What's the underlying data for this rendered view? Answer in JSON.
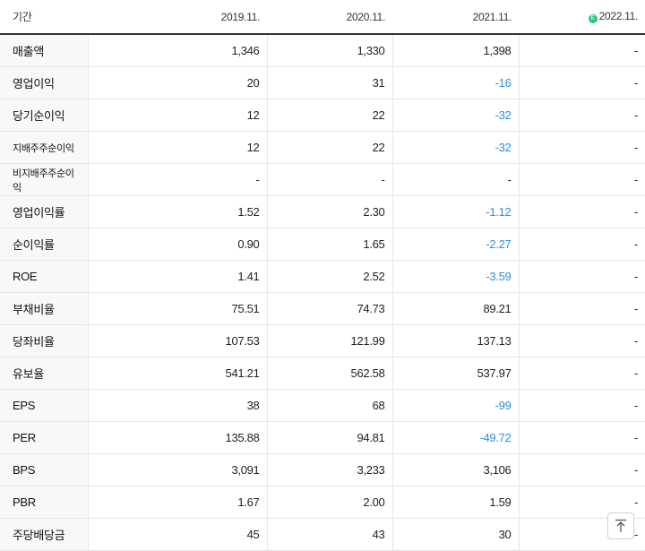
{
  "header": {
    "label": "기간",
    "periods": [
      "2019.11.",
      "2020.11.",
      "2021.11.",
      "2022.11."
    ],
    "estimate_badge": "E"
  },
  "rows": [
    {
      "label": "매출액",
      "values": [
        "1,346",
        "1,330",
        "1,398",
        "-"
      ]
    },
    {
      "label": "영업이익",
      "values": [
        "20",
        "31",
        "-16",
        "-"
      ]
    },
    {
      "label": "당기순이익",
      "values": [
        "12",
        "22",
        "-32",
        "-"
      ]
    },
    {
      "label": "지배주주순이익",
      "values": [
        "12",
        "22",
        "-32",
        "-"
      ]
    },
    {
      "label": "비지배주주순이익",
      "values": [
        "-",
        "-",
        "-",
        "-"
      ]
    },
    {
      "label": "영업이익률",
      "values": [
        "1.52",
        "2.30",
        "-1.12",
        "-"
      ]
    },
    {
      "label": "순이익률",
      "values": [
        "0.90",
        "1.65",
        "-2.27",
        "-"
      ]
    },
    {
      "label": "ROE",
      "values": [
        "1.41",
        "2.52",
        "-3.59",
        "-"
      ]
    },
    {
      "label": "부채비율",
      "values": [
        "75.51",
        "74.73",
        "89.21",
        "-"
      ]
    },
    {
      "label": "당좌비율",
      "values": [
        "107.53",
        "121.99",
        "137.13",
        "-"
      ]
    },
    {
      "label": "유보율",
      "values": [
        "541.21",
        "562.58",
        "537.97",
        "-"
      ]
    },
    {
      "label": "EPS",
      "values": [
        "38",
        "68",
        "-99",
        "-"
      ]
    },
    {
      "label": "PER",
      "values": [
        "135.88",
        "94.81",
        "-49.72",
        "-"
      ]
    },
    {
      "label": "BPS",
      "values": [
        "3,091",
        "3,233",
        "3,106",
        "-"
      ]
    },
    {
      "label": "PBR",
      "values": [
        "1.67",
        "2.00",
        "1.59",
        "-"
      ]
    },
    {
      "label": "주당배당금",
      "values": [
        "45",
        "43",
        "30",
        "-"
      ]
    }
  ],
  "colors": {
    "negative": "#2f8fd8",
    "estimate_badge": "#2ec27e"
  }
}
